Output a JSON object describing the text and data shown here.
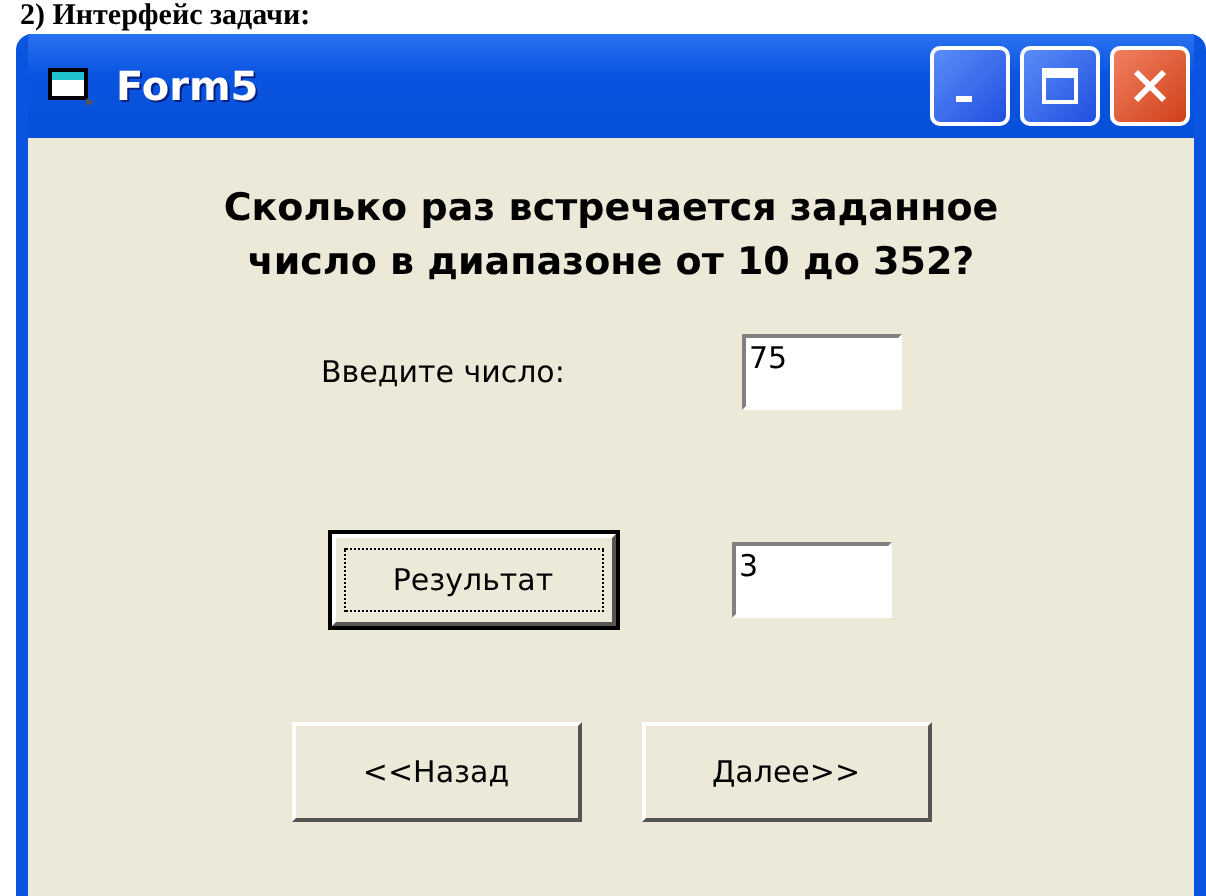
{
  "heading": "2) Интерфейс задачи:",
  "window": {
    "title": "Form5"
  },
  "question": "Сколько раз встречается заданное число в диапазоне от 10 до 352?",
  "input": {
    "label": "Введите число:",
    "value": "75"
  },
  "result_button": {
    "label": "Результат",
    "focused": true
  },
  "result": {
    "value": "3"
  },
  "nav_buttons": [
    {
      "label": "<<Назад"
    },
    {
      "label": "Далее>>"
    }
  ]
}
